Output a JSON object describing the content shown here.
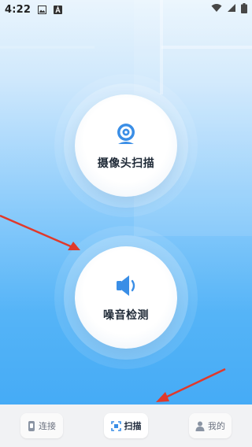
{
  "status_bar": {
    "time": "4:22",
    "icons": [
      "image-icon",
      "a-icon"
    ],
    "right_icons": [
      "wifi-icon",
      "signal-icon",
      "battery-icon"
    ]
  },
  "features": [
    {
      "label": "摄像头扫描",
      "icon": "camera-icon"
    },
    {
      "label": "噪音检测",
      "icon": "speaker-icon"
    }
  ],
  "tabs": [
    {
      "label": "连接",
      "icon": "plug-icon",
      "active": false
    },
    {
      "label": "扫描",
      "icon": "scan-icon",
      "active": true
    },
    {
      "label": "我的",
      "icon": "user-icon",
      "active": false
    }
  ],
  "colors": {
    "accent": "#3a8ee6",
    "arrow": "#e0392b"
  }
}
